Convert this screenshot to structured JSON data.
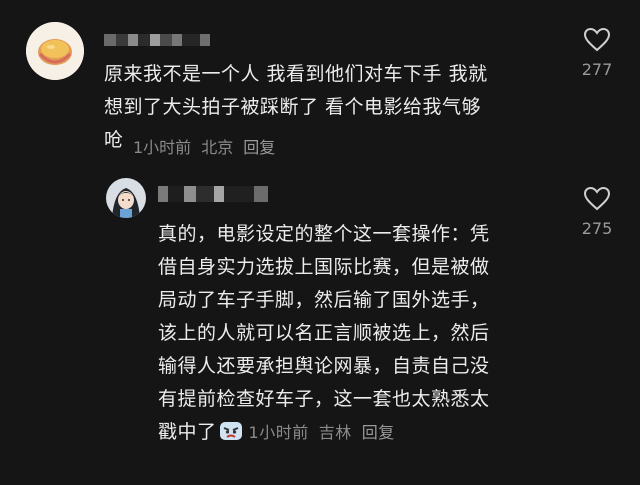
{
  "comments": [
    {
      "text_lines": [
        "原来我不是一个人 我看到他们对车下手 我就",
        "想到了大头拍子被踩断了 看个电影给我气够",
        "呛"
      ],
      "time": "1小时前",
      "location": "北京",
      "reply_label": "回复",
      "like_count": "277",
      "avatar_icon": "food-bowl-avatar",
      "like_icon": "heart-outline-icon"
    },
    {
      "text_lines": [
        "真的，电影设定的整个这一套操作：凭",
        "借自身实力选拔上国际比赛，但是被做",
        "局动了车子手脚，然后输了国外选手，",
        "该上的人就可以名正言顺被选上，然后",
        "输得人还要承担舆论网暴，自责自己没",
        "有提前检查好车子，这一套也太熟悉太",
        "戳中了"
      ],
      "emoji": "angry-face-emoji",
      "time": "1小时前",
      "location": "吉林",
      "reply_label": "回复",
      "like_count": "275",
      "avatar_icon": "anime-girl-avatar",
      "like_icon": "heart-outline-icon"
    }
  ],
  "colors": {
    "background": "#151515",
    "text": "#ececec",
    "meta": "#8a8a8a"
  }
}
